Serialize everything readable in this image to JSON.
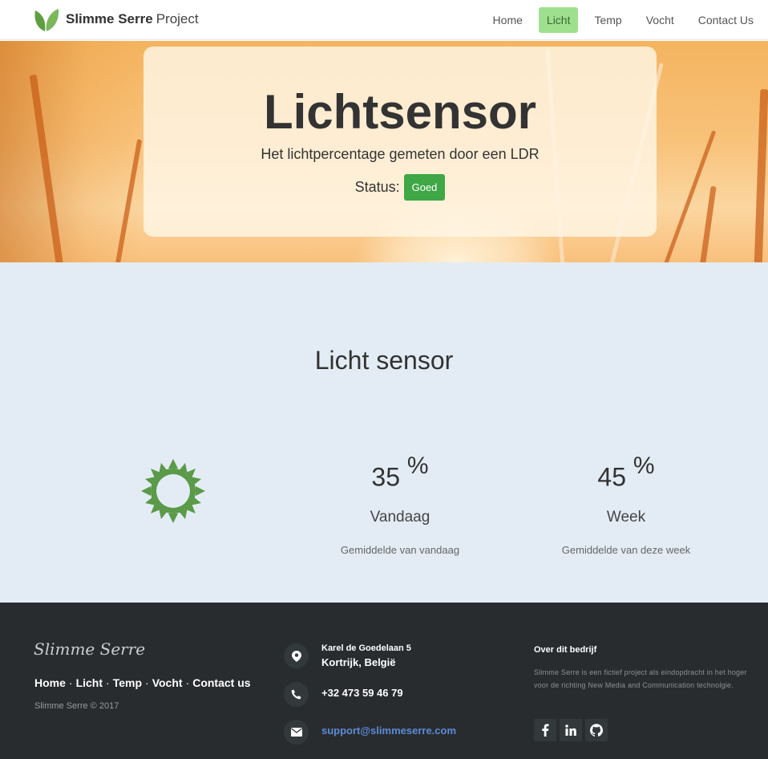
{
  "brand": {
    "bold": "Slimme Serre",
    "light": "Project"
  },
  "nav": {
    "items": [
      "Home",
      "Licht",
      "Temp",
      "Vocht",
      "Contact Us"
    ],
    "active_index": 1
  },
  "hero": {
    "title": "Lichtsensor",
    "subtitle": "Het lichtpercentage gemeten door een LDR",
    "status_label": "Status:",
    "status_badge": "Goed"
  },
  "section": {
    "title": "Licht sensor",
    "icon": "sun-icon",
    "stats": [
      {
        "value": "35",
        "unit": "%",
        "label": "Vandaag",
        "desc": "Gemiddelde van vandaag"
      },
      {
        "value": "45",
        "unit": "%",
        "label": "Week",
        "desc": "Gemiddelde van deze week"
      }
    ]
  },
  "footer": {
    "logo": "Slimme Serre",
    "links": [
      "Home",
      "Licht",
      "Temp",
      "Vocht",
      "Contact us"
    ],
    "copyright": "Slimme Serre © 2017",
    "address_line1": "Karel de Goedelaan 5",
    "address_line2": "Kortrijk, België",
    "phone": "+32 473 59 46 79",
    "email": "support@slimmeserre.com",
    "about_title": "Over dit bedrijf",
    "about_text": "Slimme Serre is een fictief project als eindopdracht in het hoger voor de richting New Media and Communication technolgie.",
    "socials": [
      "facebook-icon",
      "linkedin-icon",
      "github-icon"
    ]
  },
  "colors": {
    "accent_green": "#3fa745",
    "nav_active": "#9fe08e",
    "sun": "#5a9a48",
    "footer_bg": "#292c2f",
    "main_bg": "#e3ecf4"
  }
}
